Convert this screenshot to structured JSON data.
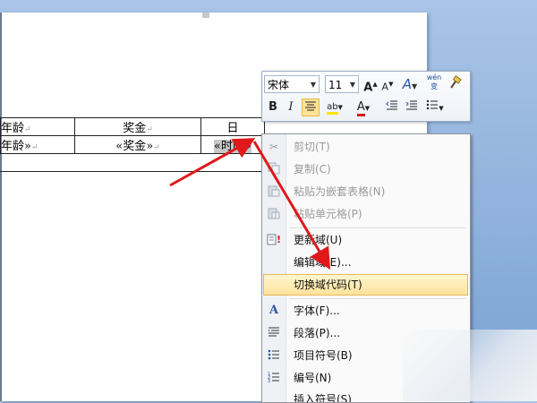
{
  "document": {
    "table": {
      "header": [
        "年龄",
        "奖金",
        "日"
      ],
      "row": [
        "年龄»",
        "«奖金»",
        "«时间»"
      ],
      "paragraph_mark": "↵"
    }
  },
  "mini_toolbar": {
    "font_name": "宋体",
    "font_size": "11",
    "grow_font": "A",
    "shrink_font": "A",
    "styles": "A",
    "phonetic": "wén 变",
    "bold": "B",
    "italic": "I",
    "highlight": "ab",
    "font_color": "A"
  },
  "context_menu": {
    "items": [
      {
        "label": "剪切(T)",
        "icon": "cut-icon",
        "enabled": false
      },
      {
        "label": "复制(C)",
        "icon": "copy-icon",
        "enabled": false
      },
      {
        "label": "粘贴为嵌套表格(N)",
        "icon": "paste-nested-table-icon",
        "enabled": false
      },
      {
        "label": "粘贴单元格(P)",
        "icon": "paste-cells-icon",
        "enabled": false
      },
      {
        "label": "更新域(U)",
        "icon": "update-field-icon",
        "enabled": true
      },
      {
        "label": "编辑域(E)...",
        "icon": "",
        "enabled": true
      },
      {
        "label": "切换域代码(T)",
        "icon": "",
        "enabled": true,
        "highlighted": true
      },
      {
        "label": "字体(F)...",
        "icon": "font-icon",
        "enabled": true
      },
      {
        "label": "段落(P)...",
        "icon": "paragraph-icon",
        "enabled": true
      },
      {
        "label": "项目符号(B)",
        "icon": "bullets-icon",
        "enabled": true
      },
      {
        "label": "编号(N)",
        "icon": "numbering-icon",
        "enabled": true
      },
      {
        "label": "插入符号(S)",
        "icon": "",
        "enabled": true
      }
    ]
  },
  "colors": {
    "highlight_bg": "#ffe29b",
    "arrow": "#e0191b",
    "font_color_red": "#d41a1a",
    "highlighter_yellow": "#ffe600"
  }
}
